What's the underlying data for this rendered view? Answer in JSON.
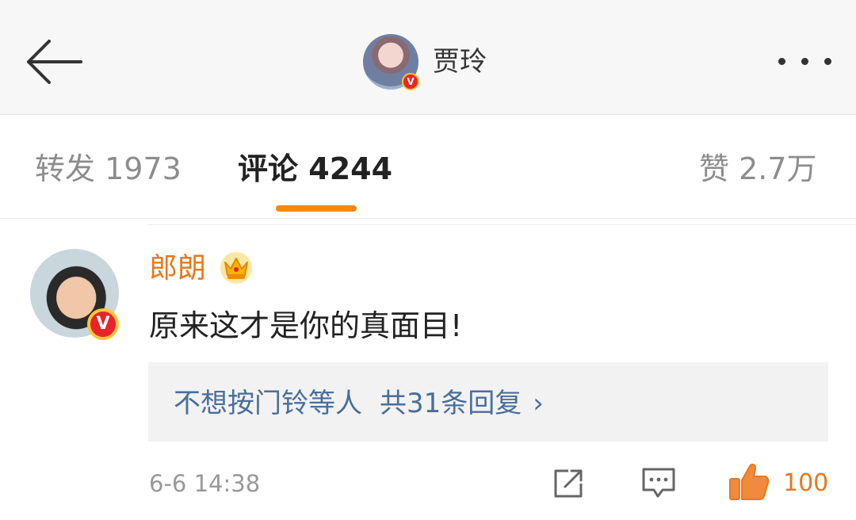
{
  "header": {
    "back_icon": "arrow-left-icon",
    "title": "贾玲",
    "verified_badge": "V",
    "more_icon": "ellipsis-icon"
  },
  "tabs": {
    "repost": {
      "label": "转发",
      "count": "1973"
    },
    "comment": {
      "label": "评论",
      "count": "4244"
    },
    "like": {
      "label": "赞",
      "count": "2.7万"
    },
    "active": "comment",
    "accent_color": "#f6880d"
  },
  "comment": {
    "username": "郎朗",
    "username_color": "#e8791d",
    "badge_icon": "crown-icon",
    "verified_badge": "V",
    "text": "原来这才是你的真面目!",
    "reply_preview": {
      "author": "不想按门铃等人",
      "summary": "共31条回复",
      "chevron": "›",
      "link_color": "#4a6d9a"
    },
    "timestamp": "6-6 14:38",
    "actions": {
      "share_icon": "share-icon",
      "comment_icon": "comment-icon",
      "like_icon": "thumbs-up-icon",
      "like_count": "100"
    }
  }
}
